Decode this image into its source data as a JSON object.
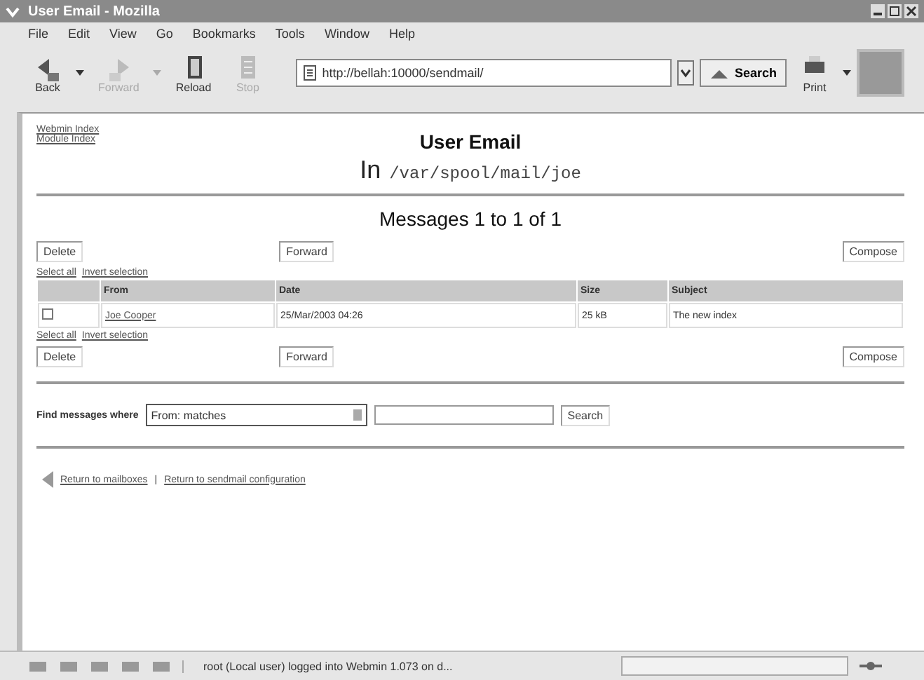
{
  "window": {
    "title": "User Email - Mozilla"
  },
  "menu": [
    "File",
    "Edit",
    "View",
    "Go",
    "Bookmarks",
    "Tools",
    "Window",
    "Help"
  ],
  "toolbar": {
    "buttons": [
      {
        "label": "Back",
        "disabled": false,
        "kind": "back"
      },
      {
        "label": "Forward",
        "disabled": true,
        "kind": "forward"
      },
      {
        "label": "Reload",
        "disabled": false,
        "kind": "reload"
      },
      {
        "label": "Stop",
        "disabled": true,
        "kind": "stop"
      }
    ],
    "url": "http://bellah:10000/sendmail/",
    "search": "Search",
    "print": "Print"
  },
  "page": {
    "top_links": [
      "Webmin Index",
      "Module Index"
    ],
    "title": "User Email",
    "subtitle_prefix": "In",
    "subtitle_path": "/var/spool/mail/joe",
    "heading": "Messages 1 to 1 of 1",
    "actions": [
      "Delete",
      "Forward",
      "Compose"
    ],
    "select_links": [
      "Select all",
      "Invert selection"
    ],
    "table": {
      "columns": [
        "From",
        "Date",
        "Size",
        "Subject"
      ],
      "rows": [
        {
          "checked": false,
          "cells": [
            "Joe Cooper",
            "25/Mar/2003 04:26",
            "25 kB",
            "The new index"
          ]
        }
      ]
    },
    "actions_bottom": [
      "Delete",
      "Forward",
      "Compose"
    ],
    "select_links_bottom": [
      "Select all",
      "Invert selection"
    ],
    "find": {
      "label": "Find messages where",
      "select": "From: matches",
      "button": "Search"
    },
    "footer_links": [
      "Return to mailboxes",
      "Return to sendmail configuration"
    ],
    "footer_separator": "|"
  },
  "status_bar": {
    "text": "root (Local user) logged into Webmin 1.073 on d..."
  }
}
